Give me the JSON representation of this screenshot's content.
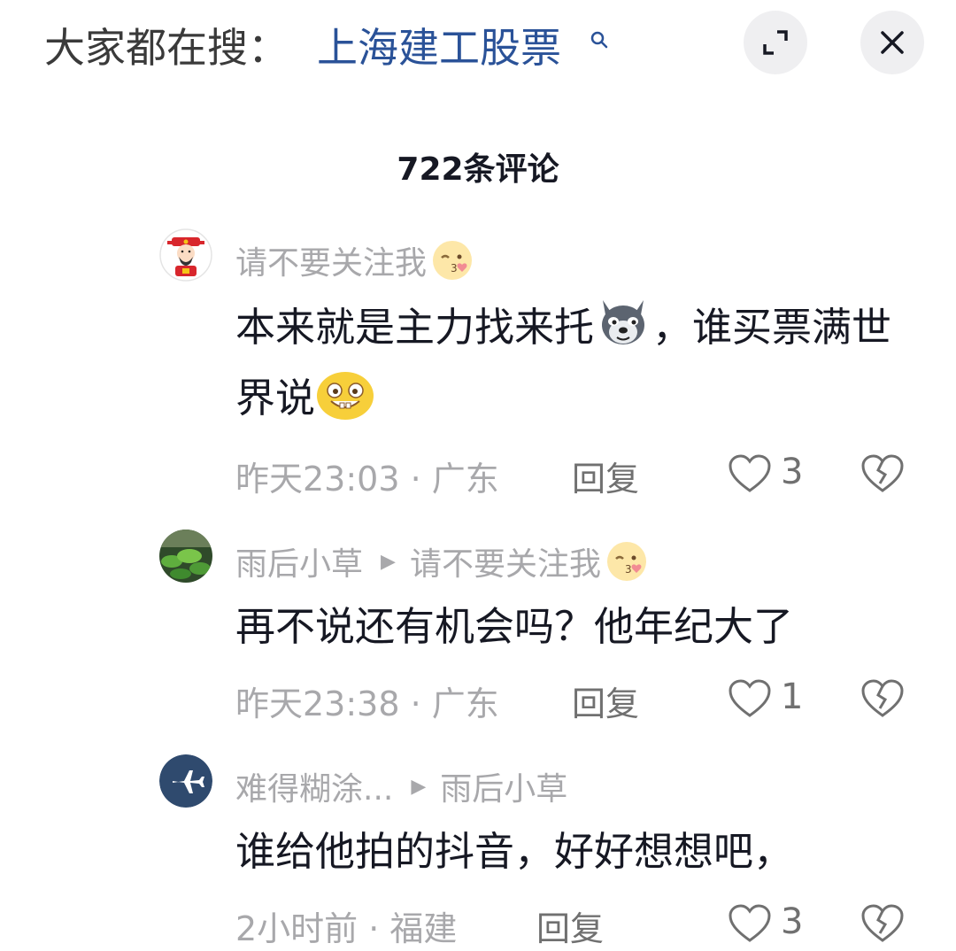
{
  "topbar": {
    "search_prefix": "大家都在搜：",
    "search_keyword": "上海建工股票",
    "icons": {
      "search": "search-icon",
      "expand": "expand-icon",
      "close": "close-icon"
    }
  },
  "comments_title": "722条评论",
  "comments": [
    {
      "username": "请不要关注我",
      "username_emoji": "kiss-wink-emoji",
      "text_a": "本来就是主力找来托",
      "emoji_a": "wolf-emoji",
      "text_b": "，谁买票满世界说",
      "emoji_b": "grin-emoji",
      "time_location": "昨天23:03 · 广东",
      "reply_label": "回复",
      "likes": "3"
    },
    {
      "username": "雨后小草",
      "reply_to": "请不要关注我",
      "reply_to_emoji": "kiss-wink-emoji",
      "text": "再不说还有机会吗？他年纪大了",
      "time_location": "昨天23:38 · 广东",
      "reply_label": "回复",
      "likes": "1"
    },
    {
      "username": "难得糊涂...",
      "reply_to": "雨后小草",
      "text": "谁给他拍的抖音，好好想想吧，",
      "time_location": "2小时前 · 福建",
      "reply_label": "回复",
      "likes": "3"
    }
  ],
  "colors": {
    "keyword": "#2a5298",
    "muted": "#a8a8ab",
    "text": "#161823",
    "avatar_plane_bg": "#2f4a6e"
  }
}
